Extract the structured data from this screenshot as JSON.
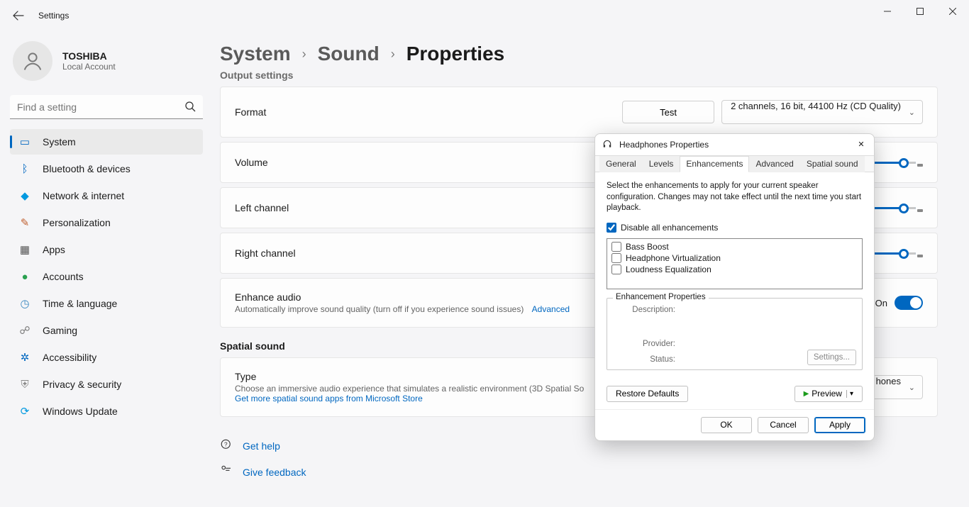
{
  "window": {
    "title": "Settings"
  },
  "user": {
    "name": "TOSHIBA",
    "sub": "Local Account"
  },
  "search": {
    "placeholder": "Find a setting"
  },
  "nav": {
    "items": [
      {
        "label": "System"
      },
      {
        "label": "Bluetooth & devices"
      },
      {
        "label": "Network & internet"
      },
      {
        "label": "Personalization"
      },
      {
        "label": "Apps"
      },
      {
        "label": "Accounts"
      },
      {
        "label": "Time & language"
      },
      {
        "label": "Gaming"
      },
      {
        "label": "Accessibility"
      },
      {
        "label": "Privacy & security"
      },
      {
        "label": "Windows Update"
      }
    ]
  },
  "breadcrumb": {
    "a": "System",
    "b": "Sound",
    "c": "Properties"
  },
  "sections": {
    "output": "Output settings",
    "spatial": "Spatial sound"
  },
  "cards": {
    "format": {
      "label": "Format",
      "test": "Test",
      "select": "2 channels, 16 bit, 44100 Hz (CD Quality)"
    },
    "volume": {
      "label": "Volume"
    },
    "left": {
      "label": "Left channel"
    },
    "right": {
      "label": "Right channel"
    },
    "enhance": {
      "label": "Enhance audio",
      "sub": "Automatically improve sound quality (turn off if you experience sound issues)",
      "advanced": "Advanced",
      "toggle": "On"
    },
    "type": {
      "label": "Type",
      "sub": "Choose an immersive audio experience that simulates a realistic environment (3D Spatial So",
      "store": "Get more spatial sound apps from Microsoft Store",
      "select_suffix": "hones"
    }
  },
  "help": {
    "get": "Get help",
    "feedback": "Give feedback"
  },
  "dialog": {
    "title": "Headphones Properties",
    "tabs": {
      "general": "General",
      "levels": "Levels",
      "enhancements": "Enhancements",
      "advanced": "Advanced",
      "spatial": "Spatial sound"
    },
    "desc": "Select the enhancements to apply for your current speaker configuration. Changes may not take effect until the next time you start playback.",
    "disable": "Disable all enhancements",
    "enh": {
      "bass": "Bass Boost",
      "virt": "Headphone Virtualization",
      "loud": "Loudness Equalization"
    },
    "props": {
      "legend": "Enhancement Properties",
      "description": "Description:",
      "provider": "Provider:",
      "status": "Status:",
      "settings": "Settings..."
    },
    "restore": "Restore Defaults",
    "preview": "Preview",
    "ok": "OK",
    "cancel": "Cancel",
    "apply": "Apply"
  }
}
